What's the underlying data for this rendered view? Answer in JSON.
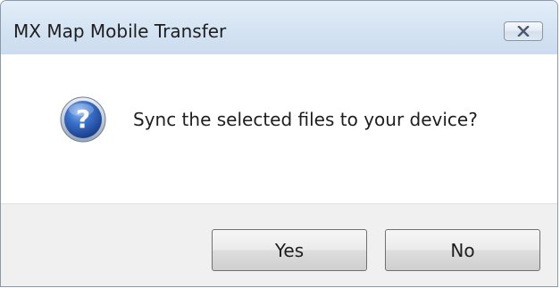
{
  "window": {
    "title": "MX Map Mobile Transfer",
    "close_icon": "close-icon"
  },
  "dialog": {
    "icon": "question-icon",
    "message": "Sync the selected files to your device?"
  },
  "buttons": {
    "yes_label": "Yes",
    "no_label": "No"
  },
  "colors": {
    "titlebar": "#d5e4f3",
    "content_bg": "#ffffff",
    "footer_bg": "#f0f0f0",
    "icon_blue": "#2c5fb3"
  }
}
